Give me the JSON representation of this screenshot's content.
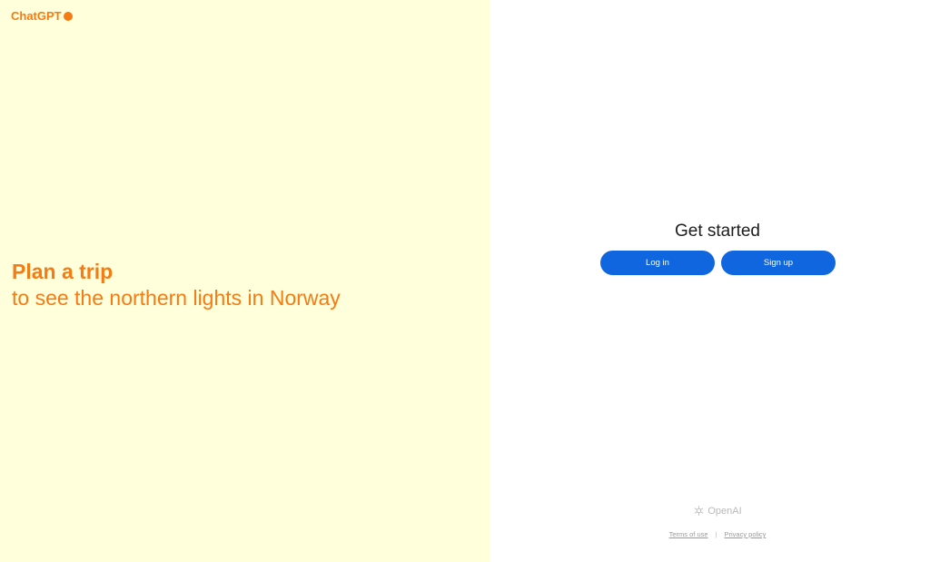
{
  "brand": {
    "name": "ChatGPT",
    "color": "#f57b14"
  },
  "hero": {
    "title": "Plan a trip",
    "subtitle": "to see the northern lights in Norway"
  },
  "auth": {
    "title": "Get started",
    "login_label": "Log in",
    "signup_label": "Sign up",
    "button_color": "#0f66de"
  },
  "footer": {
    "logo_text": "OpenAI",
    "separator": "|",
    "terms_label": "Terms of use",
    "privacy_label": "Privacy policy"
  },
  "colors": {
    "left_background": "#ffffdc",
    "right_background": "#ffffff"
  }
}
